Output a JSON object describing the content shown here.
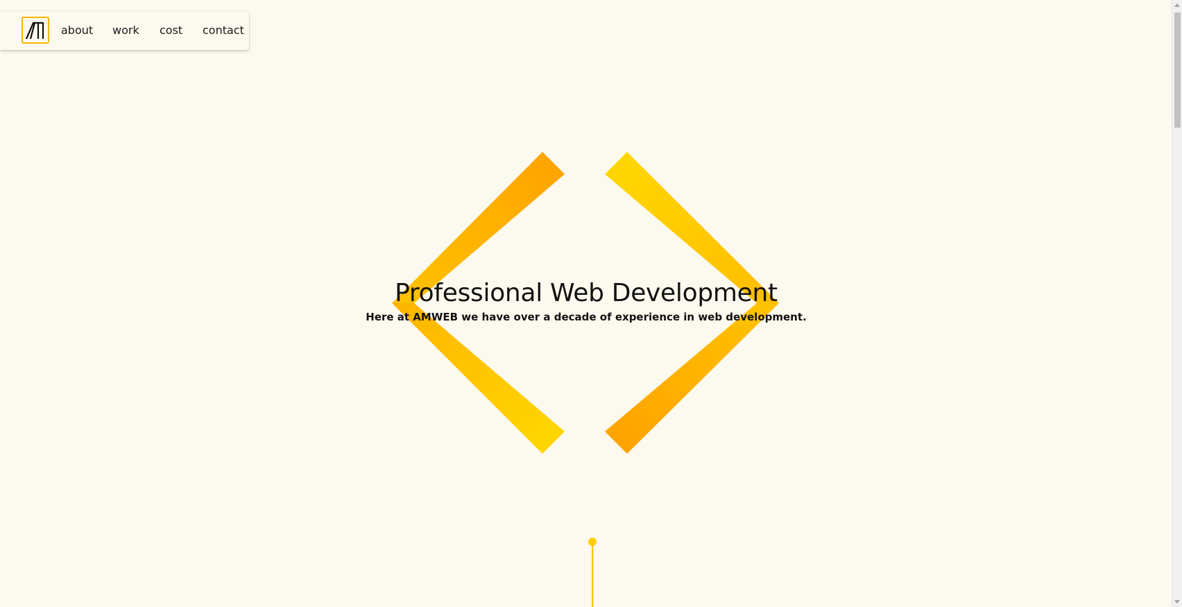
{
  "nav": {
    "logo_alt": "AMWEB logo",
    "links": [
      {
        "label": "about"
      },
      {
        "label": "work"
      },
      {
        "label": "cost"
      },
      {
        "label": "contact"
      }
    ]
  },
  "hero": {
    "title": "Professional Web Development",
    "subtitle": "Here at AMWEB we have over a decade of experience in web development."
  },
  "colors": {
    "background": "#fcf9ee",
    "accent_light": "#ffd700",
    "accent_dark": "#ffa500",
    "logo_border": "#f6b800"
  },
  "icons": {
    "logo": "amweb-logo-icon",
    "hero_graphic": "code-brackets-icon",
    "scroll": "scroll-down-indicator-icon"
  }
}
